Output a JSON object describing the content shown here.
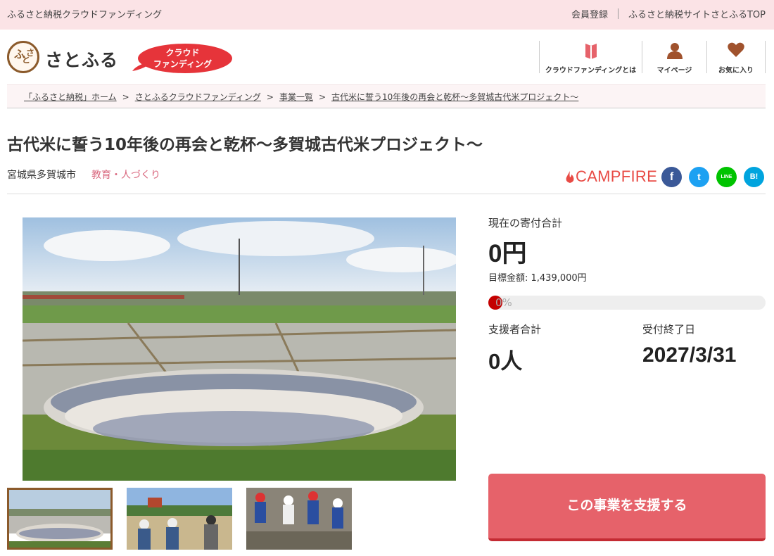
{
  "topbar": {
    "brand": "ふるさと納税クラウドファンディング",
    "register": "会員登録",
    "site_top": "ふるさと納税サイトさとふるTOP"
  },
  "header": {
    "logo_text": "さとふる",
    "logo_mark": [
      "ふ",
      "さ",
      "と"
    ],
    "badge_line1": "クラウド",
    "badge_line2": "ファンディング",
    "nav": [
      {
        "label": "クラウドファンディングとは",
        "icon": "book-icon"
      },
      {
        "label": "マイページ",
        "icon": "user-icon"
      },
      {
        "label": "お気に入り",
        "icon": "heart-icon"
      }
    ]
  },
  "breadcrumb": {
    "home": "「ふるさと納税」ホーム",
    "cf": "さとふるクラウドファンディング",
    "list": "事業一覧",
    "current": "古代米に誓う10年後の再会と乾杯～多賀城古代米プロジェクト～",
    "separator": ">"
  },
  "project": {
    "title": "古代米に誓う10年後の再会と乾杯～多賀城古代米プロジェクト～",
    "location": "宮城県多賀城市",
    "category": "教育・人づくり"
  },
  "partner": {
    "name": "CAMPFIRE"
  },
  "social": [
    {
      "name": "facebook",
      "glyph": "f",
      "color": "#3b5998"
    },
    {
      "name": "twitter",
      "glyph": "t",
      "color": "#1da1f2"
    },
    {
      "name": "line",
      "glyph": "LINE",
      "color": "#00c300"
    },
    {
      "name": "hatena",
      "glyph": "B!",
      "color": "#00a4de"
    }
  ],
  "funding": {
    "current_label": "現在の寄付合計",
    "current_amount": "0円",
    "goal_text": "目標金額: 1,439,000円",
    "progress_percent": "0%",
    "progress_value": 0,
    "supporters_label": "支援者合計",
    "supporters_value": "0人",
    "deadline_label": "受付終了日",
    "deadline_value": "2027/3/31"
  },
  "cta": {
    "support_label": "この事業を支援する"
  },
  "colors": {
    "accent_pink": "#fbe3e6",
    "button": "#e6626a",
    "category": "#d9677e",
    "campfire": "#e84b45",
    "brand_brown": "#8b5a2b"
  }
}
